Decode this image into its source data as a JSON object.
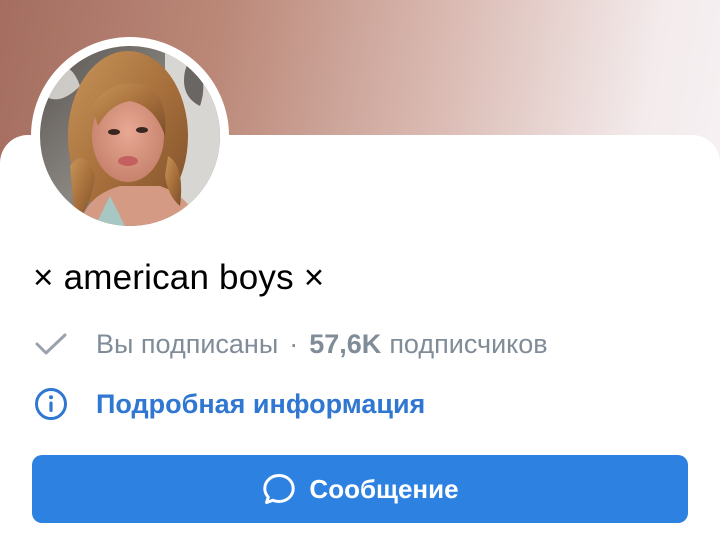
{
  "profile": {
    "title": "× american boys ×",
    "subscription_status": "Вы подписаны",
    "separator": "·",
    "subscribers_count": "57,6K",
    "subscribers_label": "подписчиков",
    "details_link": "Подробная информация"
  },
  "actions": {
    "message_label": "Сообщение"
  },
  "icons": {
    "subscribed": "check-icon",
    "details": "info-icon",
    "message": "message-bubble-icon"
  },
  "colors": {
    "accent": "#2d81e0",
    "link": "#2f77d1",
    "secondary_text": "#818c99"
  }
}
